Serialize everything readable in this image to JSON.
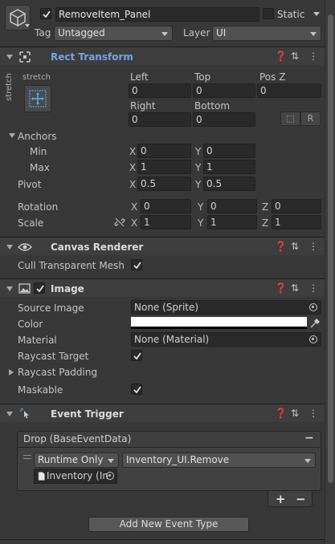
{
  "header": {
    "object_name": "RemoveItem_Panel",
    "static_label": "Static",
    "tag_label": "Tag",
    "tag_value": "Untagged",
    "layer_label": "Layer",
    "layer_value": "UI"
  },
  "rect_transform": {
    "title": "Rect Transform",
    "anchor_preset_top": "stretch",
    "anchor_preset_side": "stretch",
    "left_label": "Left",
    "left_value": "0",
    "top_label": "Top",
    "top_value": "0",
    "posz_label": "Pos Z",
    "posz_value": "0",
    "right_label": "Right",
    "right_value": "0",
    "bottom_label": "Bottom",
    "bottom_value": "0",
    "raw_button": "R",
    "anchors_label": "Anchors",
    "min_label": "Min",
    "min_x": "0",
    "min_y": "0",
    "max_label": "Max",
    "max_x": "1",
    "max_y": "1",
    "pivot_label": "Pivot",
    "pivot_x": "0.5",
    "pivot_y": "0.5",
    "rotation_label": "Rotation",
    "rot_x": "0",
    "rot_y": "0",
    "rot_z": "0",
    "scale_label": "Scale",
    "scale_x": "1",
    "scale_y": "1",
    "scale_z": "1",
    "x": "X",
    "y": "Y",
    "z": "Z"
  },
  "canvas_renderer": {
    "title": "Canvas Renderer",
    "cull_label": "Cull Transparent Mesh"
  },
  "image": {
    "title": "Image",
    "source_image_label": "Source Image",
    "source_image_value": "None (Sprite)",
    "color_label": "Color",
    "color_value": "#ffffff",
    "material_label": "Material",
    "material_value": "None (Material)",
    "raycast_target_label": "Raycast Target",
    "raycast_padding_label": "Raycast Padding",
    "maskable_label": "Maskable"
  },
  "event_trigger": {
    "title": "Event Trigger",
    "entry_title": "Drop (BaseEventData)",
    "remove_entry": "−",
    "runtime_value": "Runtime Only",
    "function_value": "Inventory_UI.Remove",
    "object_value": "Inventory (In",
    "add_listener": "+",
    "remove_listener": "−",
    "add_event_button": "Add New Event Type"
  }
}
